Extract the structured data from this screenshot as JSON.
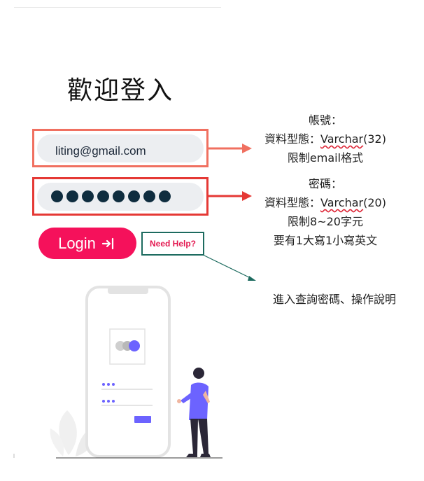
{
  "title": "歡迎登入",
  "email": {
    "value": "liting@gmail.com"
  },
  "password": {
    "dots": 8
  },
  "login": {
    "label": "Login"
  },
  "help": {
    "label": "Need Help?"
  },
  "notes": {
    "account": {
      "line1": "帳號：",
      "line2_prefix": "資料型態：",
      "line2_type": "Varchar",
      "line2_suffix": "(32)",
      "line3": "限制email格式"
    },
    "password": {
      "line1": "密碼：",
      "line2_prefix": "資料型態：",
      "line2_type": "Varchar",
      "line2_suffix": "(20)",
      "line3": "限制8~20字元",
      "line4": "要有1大寫1小寫英文"
    },
    "help": {
      "line1": "進入查詢密碼、操作說明"
    }
  },
  "colors": {
    "accent": "#f5115b",
    "email_box": "#f07060",
    "password_box": "#e53935",
    "help_box": "#1d6b5f",
    "illustration_purple": "#6c63ff"
  },
  "icons": {
    "login": "login-arrow-icon"
  }
}
